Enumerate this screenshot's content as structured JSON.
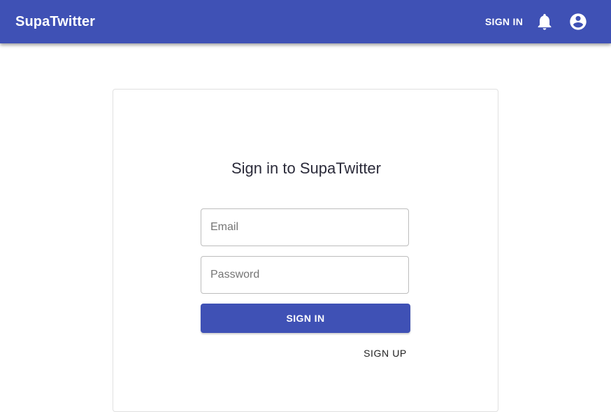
{
  "appbar": {
    "brand": "SupaTwitter",
    "signin_label": "SIGN IN",
    "bell_icon": "notifications-icon",
    "account_icon": "account-circle-icon",
    "color": "#3f51b5"
  },
  "form": {
    "title": "Sign in to SupaTwitter",
    "email_placeholder": "Email",
    "email_value": "",
    "password_placeholder": "Password",
    "password_value": "",
    "submit_label": "SIGN IN",
    "signup_label": "SIGN UP"
  }
}
